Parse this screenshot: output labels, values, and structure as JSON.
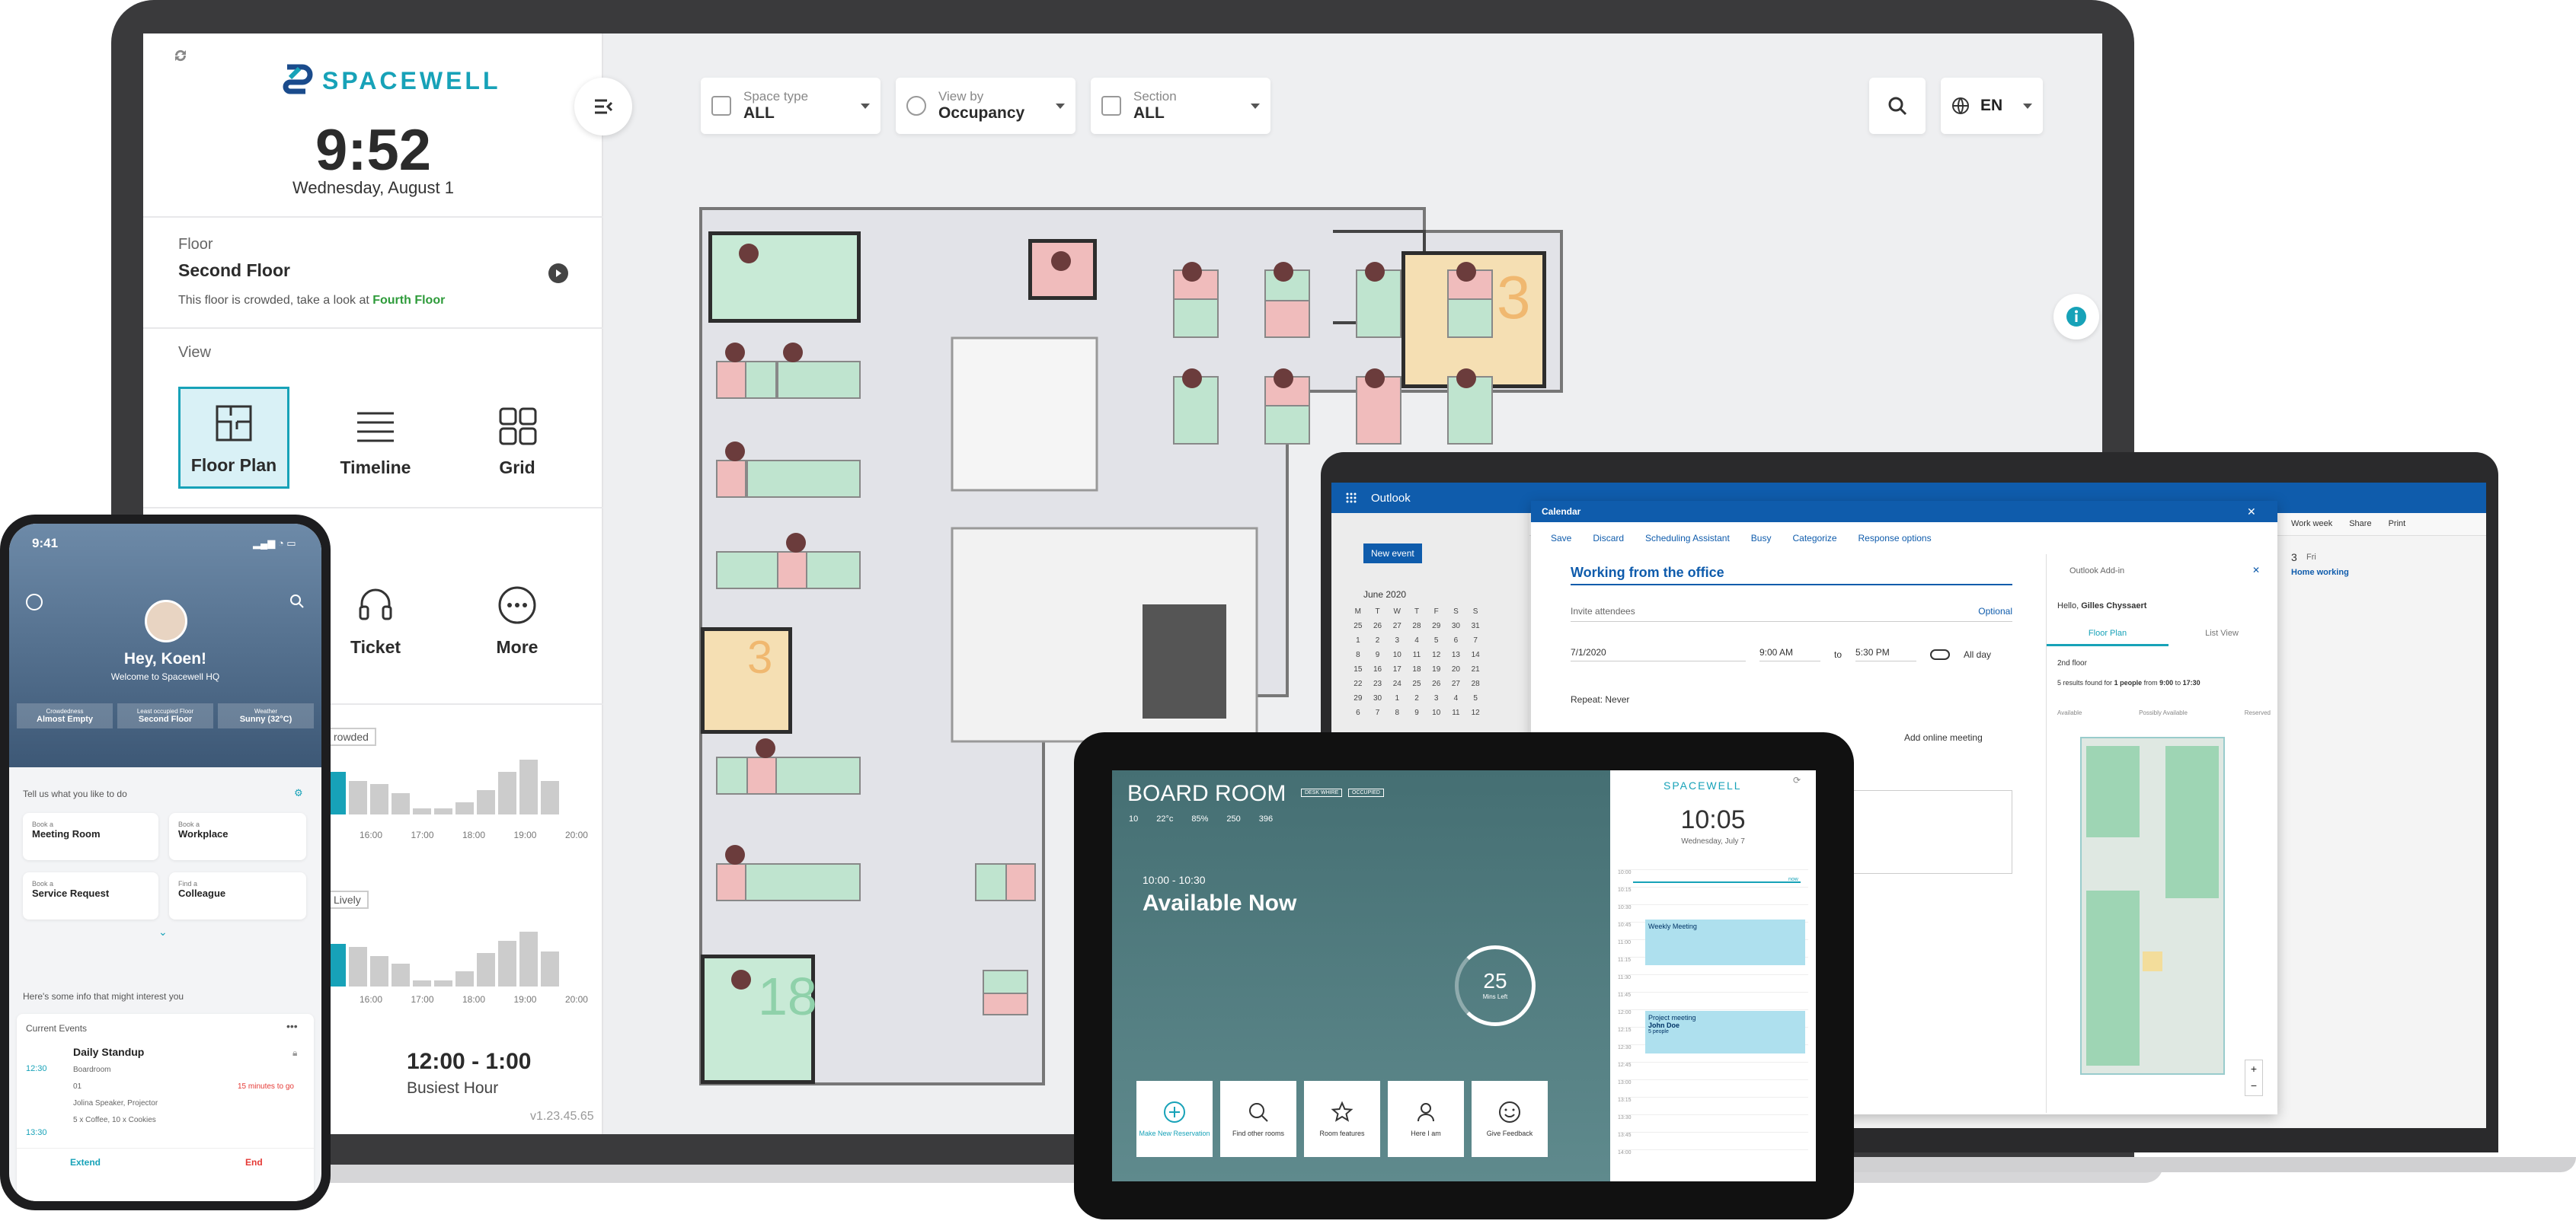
{
  "main_app": {
    "brand": "SPACEWELL",
    "time": "9:52",
    "date": "Wednesday, August 1",
    "floor_label": "Floor",
    "floor_value": "Second Floor",
    "crowded_msg": "This floor is crowded, take a look at",
    "crowded_link": "Fourth Floor",
    "view_label": "View",
    "views": [
      "Floor Plan",
      "Timeline",
      "Grid"
    ],
    "actions": [
      "Ticket",
      "More"
    ],
    "chart_labels_1": [
      "16:00",
      "17:00",
      "18:00",
      "19:00",
      "20:00"
    ],
    "chart_labels_2": [
      "16:00",
      "17:00",
      "18:00",
      "19:00",
      "20:00"
    ],
    "tag1": "rowded",
    "tag2": "Lively",
    "busiest_time": "12:00 - 1:00",
    "busiest_label": "Busiest Hour",
    "version": "v1.23.45.65",
    "filters": [
      {
        "label": "Space type",
        "value": "ALL"
      },
      {
        "label": "View by",
        "value": "Occupancy"
      },
      {
        "label": "Section",
        "value": "ALL"
      }
    ],
    "language": "EN",
    "room_numbers": [
      "3",
      "3",
      "18"
    ],
    "colors": {
      "accent": "#17a2b8",
      "free": "#bfe4cf",
      "busy": "#f0bcbc",
      "green_link": "#2e9b3a"
    }
  },
  "phone": {
    "status_time": "9:41",
    "greeting": "Hey, Koen!",
    "welcome": "Welcome to Spacewell HQ",
    "stats": [
      {
        "label": "Crowdedness",
        "value": "Almost Empty"
      },
      {
        "label": "Least occupied Floor",
        "value": "Second Floor"
      },
      {
        "label": "Weather",
        "value": "Sunny (32°C)"
      }
    ],
    "prompt": "Tell us what you like to do",
    "tiles": [
      {
        "pre": "Book a",
        "title": "Meeting Room"
      },
      {
        "pre": "Book a",
        "title": "Workplace"
      },
      {
        "pre": "Book a",
        "title": "Service Request"
      },
      {
        "pre": "Find a",
        "title": "Colleague"
      }
    ],
    "info_prompt": "Here's some info that might interest you",
    "events_title": "Current Events",
    "event": {
      "start": "12:30",
      "end": "13:30",
      "title": "Daily Standup",
      "location": "Boardroom",
      "count": "01",
      "people": "Jolina Speaker, Projector",
      "catering": "5 x Coffee, 10 x Cookies",
      "countdown": "15 minutes to go"
    },
    "extend": "Extend",
    "end_btn": "End"
  },
  "tablet": {
    "room": "BOARD ROOM",
    "badges": [
      "DESK WHIRE",
      "OCCUPIED"
    ],
    "specs": [
      "10",
      "22°c",
      "85%",
      "250",
      "396"
    ],
    "slot": "10:00 - 10:30",
    "status": "Available Now",
    "mins": "25",
    "mins_label": "Mins Left",
    "actions": [
      "Make New Reservation",
      "Find other rooms",
      "Room features",
      "Here I am",
      "Give Feedback"
    ],
    "brand": "SPACEWELL",
    "time": "10:05",
    "date": "Wednesday, July 7",
    "times": [
      "10:00",
      "10:15",
      "10:30",
      "10:45",
      "11:00",
      "11:15",
      "11:30",
      "11:45",
      "12:00",
      "12:15",
      "12:30",
      "12:45",
      "13:00",
      "13:15",
      "13:30",
      "13:45",
      "14:00"
    ],
    "now": "now",
    "events": [
      {
        "title": "Weekly Meeting",
        "sub": ""
      },
      {
        "title": "Project meeting",
        "sub": "John Doe"
      }
    ],
    "people": "5 people"
  },
  "outlook": {
    "app": "Outlook",
    "new_event": "New event",
    "month": "June 2020",
    "weekdays": [
      "M",
      "T",
      "W",
      "T",
      "F",
      "S",
      "S"
    ],
    "days": [
      "25",
      "26",
      "27",
      "28",
      "29",
      "30",
      "31",
      "1",
      "2",
      "3",
      "4",
      "5",
      "6",
      "7",
      "8",
      "9",
      "10",
      "11",
      "12",
      "13",
      "14",
      "15",
      "16",
      "17",
      "18",
      "19",
      "20",
      "21",
      "22",
      "23",
      "24",
      "25",
      "26",
      "27",
      "28",
      "29",
      "30",
      "1",
      "2",
      "3",
      "4",
      "5",
      "6",
      "7",
      "8",
      "9",
      "10",
      "11",
      "12"
    ],
    "calendar_title": "Calendar",
    "toolbar": [
      "Save",
      "Discard",
      "Scheduling Assistant",
      "Busy",
      "Categorize",
      "Response options"
    ],
    "event_title": "Working from the office",
    "invite": "Invite attendees",
    "optional": "Optional",
    "date": "7/1/2020",
    "from": "9:00 AM",
    "to_label": "to",
    "to": "5:30 PM",
    "allday": "All day",
    "repeat": "Repeat:",
    "repeat_value": "Never",
    "online": "Add online meeting",
    "addin_title": "Outlook Add-in",
    "hello": "Hello,",
    "user": "Gilles Chyssaert",
    "tabs": [
      "Floor Plan",
      "List View"
    ],
    "floor": "2nd floor",
    "result_pre": "5 results found for",
    "result_count": "1 people",
    "result_mid": "from",
    "result_from": "9:00",
    "result_to_label": "to",
    "result_to": "17:30",
    "legend": [
      "Available",
      "Possibly Available",
      "Reserved"
    ],
    "right_toolbar": [
      "Work week",
      "Share",
      "Print"
    ],
    "right_day": "3",
    "right_dayname": "Fri",
    "home_working": "Home working"
  }
}
